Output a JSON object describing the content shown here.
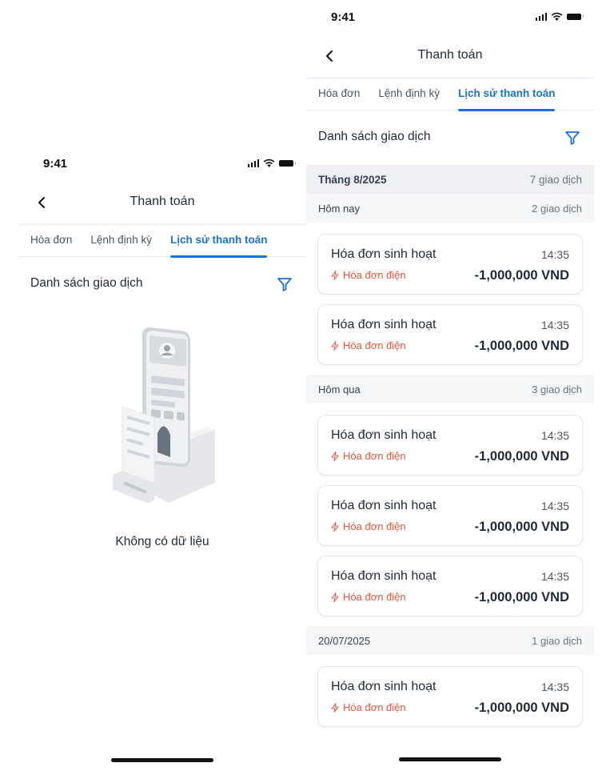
{
  "status": {
    "time": "9:41"
  },
  "nav": {
    "title": "Thanh toán"
  },
  "tabs": [
    {
      "label": "Hóa đơn",
      "active": false
    },
    {
      "label": "Lệnh định kỳ",
      "active": false
    },
    {
      "label": "Lịch sử thanh toán",
      "active": true
    }
  ],
  "list": {
    "title": "Danh sách giao dịch"
  },
  "empty_state": {
    "text": "Không có dữ liệu"
  },
  "colors": {
    "accent": "#1a73d9",
    "category": "#e8553e"
  },
  "history": {
    "month": {
      "label": "Tháng 8/2025",
      "count": "7 giao dịch"
    },
    "groups": [
      {
        "label": "Hôm nay",
        "count": "2 giao dịch",
        "items": [
          {
            "title": "Hóa đơn sinh hoạt",
            "time": "14:35",
            "category": "Hóa đơn điện",
            "amount": "-1,000,000 VND"
          },
          {
            "title": "Hóa đơn sinh hoạt",
            "time": "14:35",
            "category": "Hóa đơn điện",
            "amount": "-1,000,000 VND"
          }
        ]
      },
      {
        "label": "Hôm qua",
        "count": "3 giao dịch",
        "items": [
          {
            "title": "Hóa đơn sinh hoạt",
            "time": "14:35",
            "category": "Hóa đơn điện",
            "amount": "-1,000,000 VND"
          },
          {
            "title": "Hóa đơn sinh hoạt",
            "time": "14:35",
            "category": "Hóa đơn điện",
            "amount": "-1,000,000 VND"
          },
          {
            "title": "Hóa đơn sinh hoạt",
            "time": "14:35",
            "category": "Hóa đơn điện",
            "amount": "-1,000,000 VND"
          }
        ]
      },
      {
        "label": "20/07/2025",
        "count": "1 giao dịch",
        "items": [
          {
            "title": "Hóa đơn sinh hoạt",
            "time": "14:35",
            "category": "Hóa đơn điện",
            "amount": "-1,000,000 VND"
          }
        ]
      }
    ]
  }
}
